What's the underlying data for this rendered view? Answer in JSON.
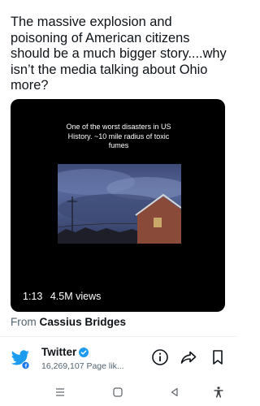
{
  "tweet": {
    "text": "The massive explosion and poisoning of American citizens should be a much bigger story....why isn’t the media talking about Ohio more?"
  },
  "video": {
    "caption": "One of the worst disasters in US History. ~10 mile radius of toxic fumes",
    "duration": "1:13",
    "views": "4.5M views"
  },
  "attribution": {
    "prefix": "From",
    "author": "Cassius Bridges"
  },
  "account": {
    "name": "Twitter",
    "subtitle": "16,269,107 Page lik...",
    "avatar_icon": "twitter-bird-icon"
  },
  "colors": {
    "twitter_blue": "#1d9bf0",
    "text_primary": "#0f1419",
    "text_secondary": "#536471"
  },
  "actions": [
    "info-icon",
    "share-icon",
    "bookmark-icon"
  ],
  "navigation": [
    "menu-icon",
    "home-icon",
    "back-icon",
    "accessibility-icon"
  ]
}
